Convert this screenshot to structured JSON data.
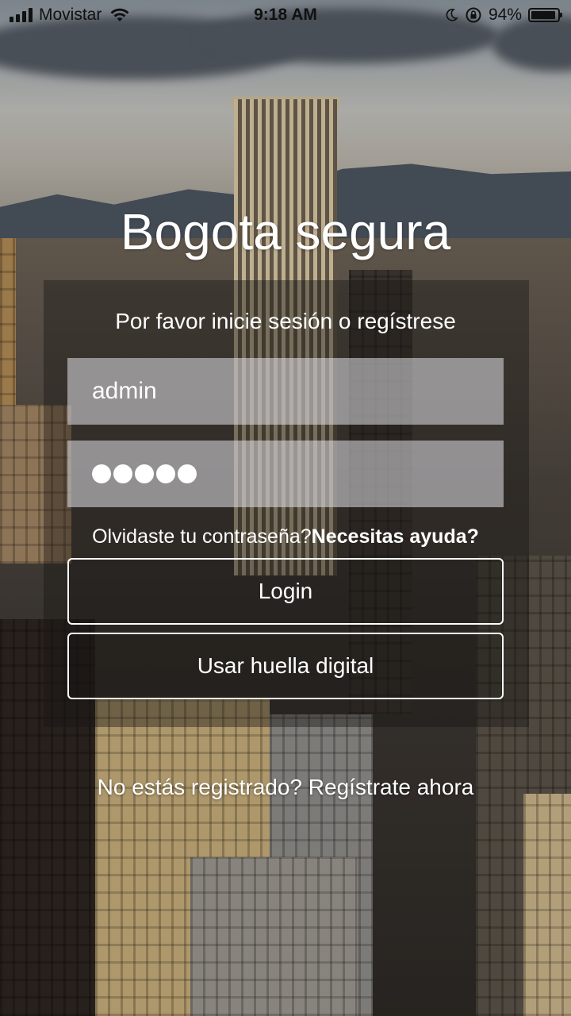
{
  "status_bar": {
    "carrier": "Movistar",
    "time": "9:18 AM",
    "battery": "94%",
    "battery_level": 0.94,
    "icons": [
      "signal-icon",
      "wifi-icon",
      "moon-icon",
      "rotation-lock-icon",
      "battery-icon"
    ]
  },
  "login": {
    "app_title": "Bogota segura",
    "prompt": "Por favor inicie sesión o regístrese",
    "username_value": "admin",
    "password_mask_count": 5,
    "forgot_password": "Olvidaste tu contraseña?",
    "need_help": "Necesitas ayuda?",
    "login_button": "Login",
    "fingerprint_button": "Usar huella digital",
    "register_link": "No estás registrado? Regístrate ahora"
  },
  "colors": {
    "text": "#ffffff",
    "status_text": "#111111",
    "field_bg": "rgba(225,225,232,0.55)",
    "panel_bg": "rgba(25,22,20,0.42)"
  }
}
